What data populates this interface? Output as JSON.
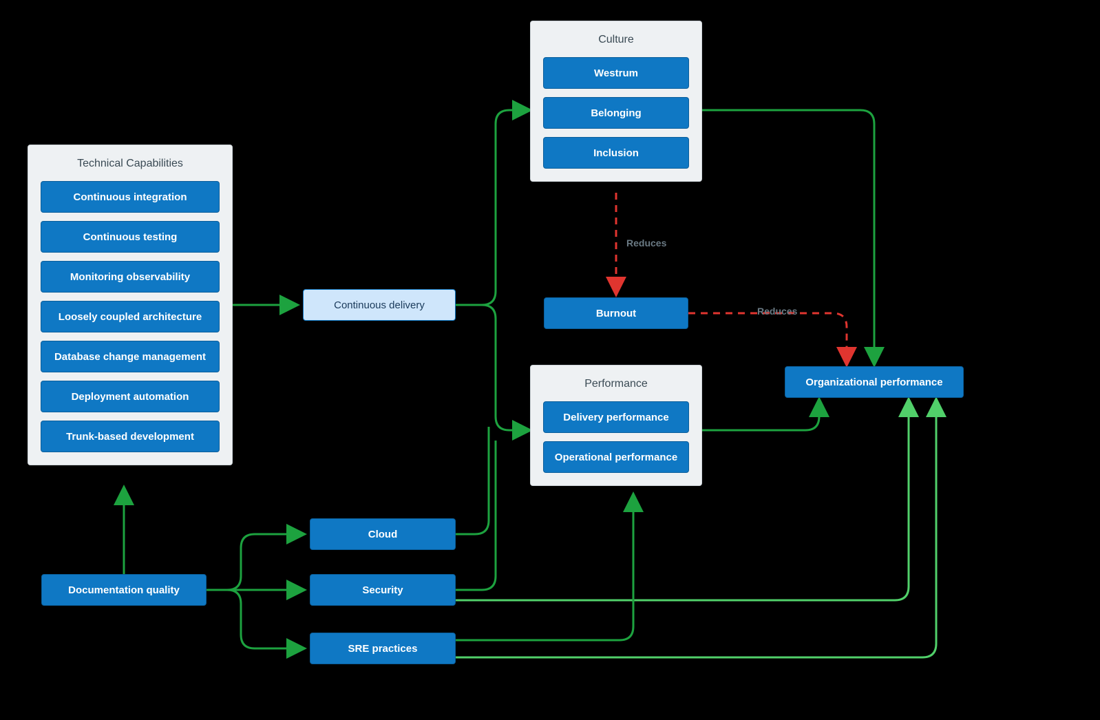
{
  "colors": {
    "panel_bg": "#eef1f3",
    "chip_bg": "#0f78c4",
    "chip_light_bg": "#cfe6fb",
    "arrow_green": "#1da23f",
    "arrow_green_light": "#51d06a",
    "arrow_red": "#e0352f"
  },
  "panels": {
    "tech": {
      "title": "Technical Capabilities",
      "items": [
        "Continuous integration",
        "Continuous testing",
        "Monitoring observability",
        "Loosely coupled architecture",
        "Database change management",
        "Deployment automation",
        "Trunk-based development"
      ]
    },
    "culture": {
      "title": "Culture",
      "items": [
        "Westrum",
        "Belonging",
        "Inclusion"
      ]
    },
    "performance": {
      "title": "Performance",
      "items": [
        "Delivery performance",
        "Operational performance"
      ]
    }
  },
  "nodes": {
    "continuous_delivery": "Continuous delivery",
    "burnout": "Burnout",
    "org_perf": "Organizational performance",
    "doc_quality": "Documentation quality",
    "cloud": "Cloud",
    "security": "Security",
    "sre": "SRE practices"
  },
  "edge_labels": {
    "reduces_a": "Reduces",
    "reduces_b": "Reduces"
  }
}
